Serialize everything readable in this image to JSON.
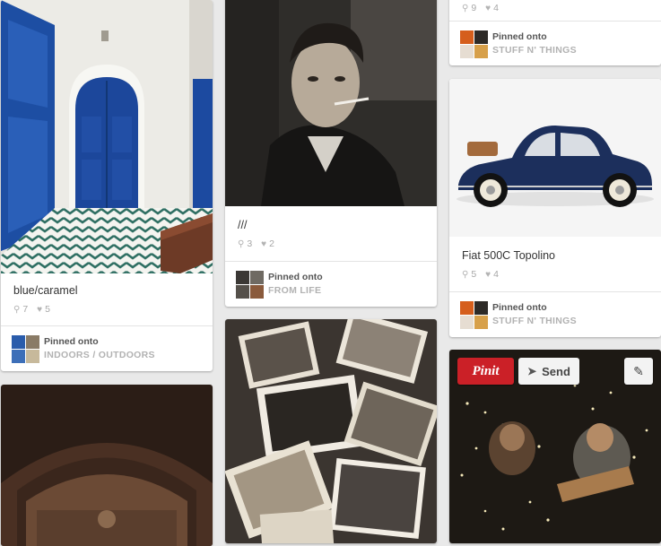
{
  "pins": {
    "blue_caramel": {
      "description": "blue/caramel",
      "repins": "7",
      "likes": "5",
      "pinned_onto": "Pinned onto",
      "board": "INDOORS / OUTDOORS"
    },
    "smoker": {
      "description": "///",
      "repins": "3",
      "likes": "2",
      "pinned_onto": "Pinned onto",
      "board": "FROM LIFE"
    },
    "top_right": {
      "repins": "9",
      "likes": "4",
      "pinned_onto": "Pinned onto",
      "board": "STUFF N' THINGS"
    },
    "fiat": {
      "description": "Fiat 500C Topolino",
      "repins": "5",
      "likes": "4",
      "pinned_onto": "Pinned onto",
      "board": "STUFF N' THINGS"
    },
    "concert": {
      "pinit_label": "Pinit",
      "send_label": "Send"
    }
  },
  "icons": {
    "repin": "pushpin-icon",
    "like": "heart-icon",
    "edit": "pencil-icon",
    "send": "paper-plane-icon"
  },
  "colors": {
    "pinit_red": "#cb2027",
    "board_gray": "#b2b2b2",
    "background": "#e9e9e9"
  }
}
